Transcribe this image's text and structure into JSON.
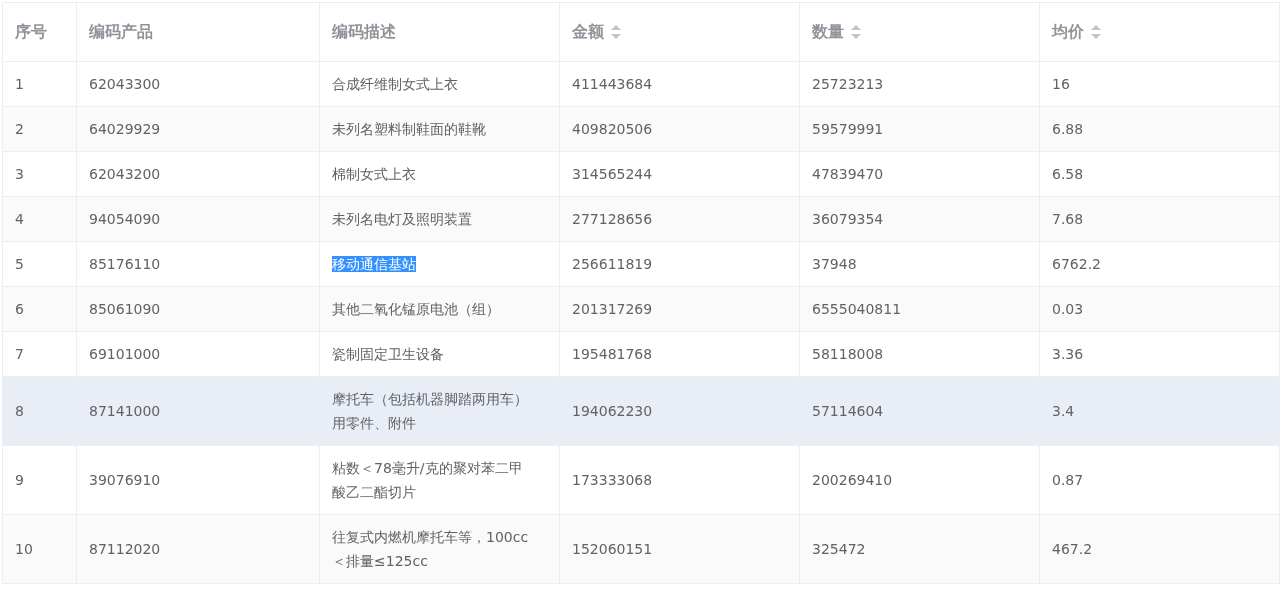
{
  "columns": [
    {
      "label": "序号",
      "sortable": false
    },
    {
      "label": "编码产品",
      "sortable": false
    },
    {
      "label": "编码描述",
      "sortable": false
    },
    {
      "label": "金额",
      "sortable": true
    },
    {
      "label": "数量",
      "sortable": true
    },
    {
      "label": "均价",
      "sortable": true
    }
  ],
  "rows": [
    {
      "index": "1",
      "code": "62043300",
      "description": "合成纤维制女式上衣",
      "amount": "411443684",
      "quantity": "25723213",
      "avg_price": "16",
      "hovered": false,
      "text_selected": false
    },
    {
      "index": "2",
      "code": "64029929",
      "description": "未列名塑料制鞋面的鞋靴",
      "amount": "409820506",
      "quantity": "59579991",
      "avg_price": "6.88",
      "hovered": false,
      "text_selected": false
    },
    {
      "index": "3",
      "code": "62043200",
      "description": "棉制女式上衣",
      "amount": "314565244",
      "quantity": "47839470",
      "avg_price": "6.58",
      "hovered": false,
      "text_selected": false
    },
    {
      "index": "4",
      "code": "94054090",
      "description": "未列名电灯及照明装置",
      "amount": "277128656",
      "quantity": "36079354",
      "avg_price": "7.68",
      "hovered": false,
      "text_selected": false
    },
    {
      "index": "5",
      "code": "85176110",
      "description": "移动通信基站",
      "amount": "256611819",
      "quantity": "37948",
      "avg_price": "6762.2",
      "hovered": false,
      "text_selected": true
    },
    {
      "index": "6",
      "code": "85061090",
      "description": "其他二氧化锰原电池（组）",
      "amount": "201317269",
      "quantity": "6555040811",
      "avg_price": "0.03",
      "hovered": false,
      "text_selected": false
    },
    {
      "index": "7",
      "code": "69101000",
      "description": "瓷制固定卫生设备",
      "amount": "195481768",
      "quantity": "58118008",
      "avg_price": "3.36",
      "hovered": false,
      "text_selected": false
    },
    {
      "index": "8",
      "code": "87141000",
      "description": "摩托车（包括机器脚踏两用车）用零件、附件",
      "amount": "194062230",
      "quantity": "57114604",
      "avg_price": "3.4",
      "hovered": true,
      "text_selected": false
    },
    {
      "index": "9",
      "code": "39076910",
      "description": "粘数＜78毫升/克的聚对苯二甲酸乙二酯切片",
      "amount": "173333068",
      "quantity": "200269410",
      "avg_price": "0.87",
      "hovered": false,
      "text_selected": false
    },
    {
      "index": "10",
      "code": "87112020",
      "description": "往复式内燃机摩托车等，100cc＜排量≤125cc",
      "amount": "152060151",
      "quantity": "325472",
      "avg_price": "467.2",
      "hovered": false,
      "text_selected": false
    }
  ]
}
